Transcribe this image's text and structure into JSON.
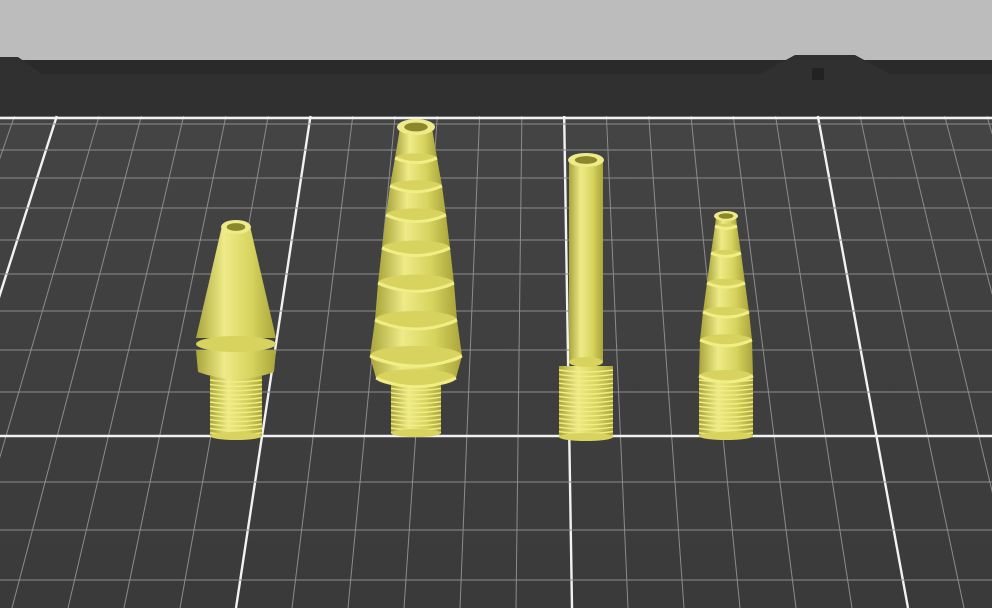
{
  "viewport": {
    "background_color": "#bcbcbc",
    "bed_color": "#3b3b3b",
    "bed_rim_color": "#303030",
    "grid_minor_color": "#8c8c8c",
    "grid_major_color": "#f2f2f2",
    "model_color": "#d7d35e",
    "model_shadow_color": "#a9a53b",
    "model_highlight_color": "#eeeb88",
    "ring_color": "#f1ee86"
  },
  "objects": [
    {
      "name": "tapered-cone-adapter",
      "shape": "cone",
      "threaded_base": true
    },
    {
      "name": "stepped-cone-adapter",
      "shape": "stepped-cone",
      "threaded_base": true
    },
    {
      "name": "straight-tube-adapter",
      "shape": "tube",
      "threaded_base": true
    },
    {
      "name": "small-stepped-adapter",
      "shape": "stepped-cone",
      "threaded_base": true
    }
  ]
}
